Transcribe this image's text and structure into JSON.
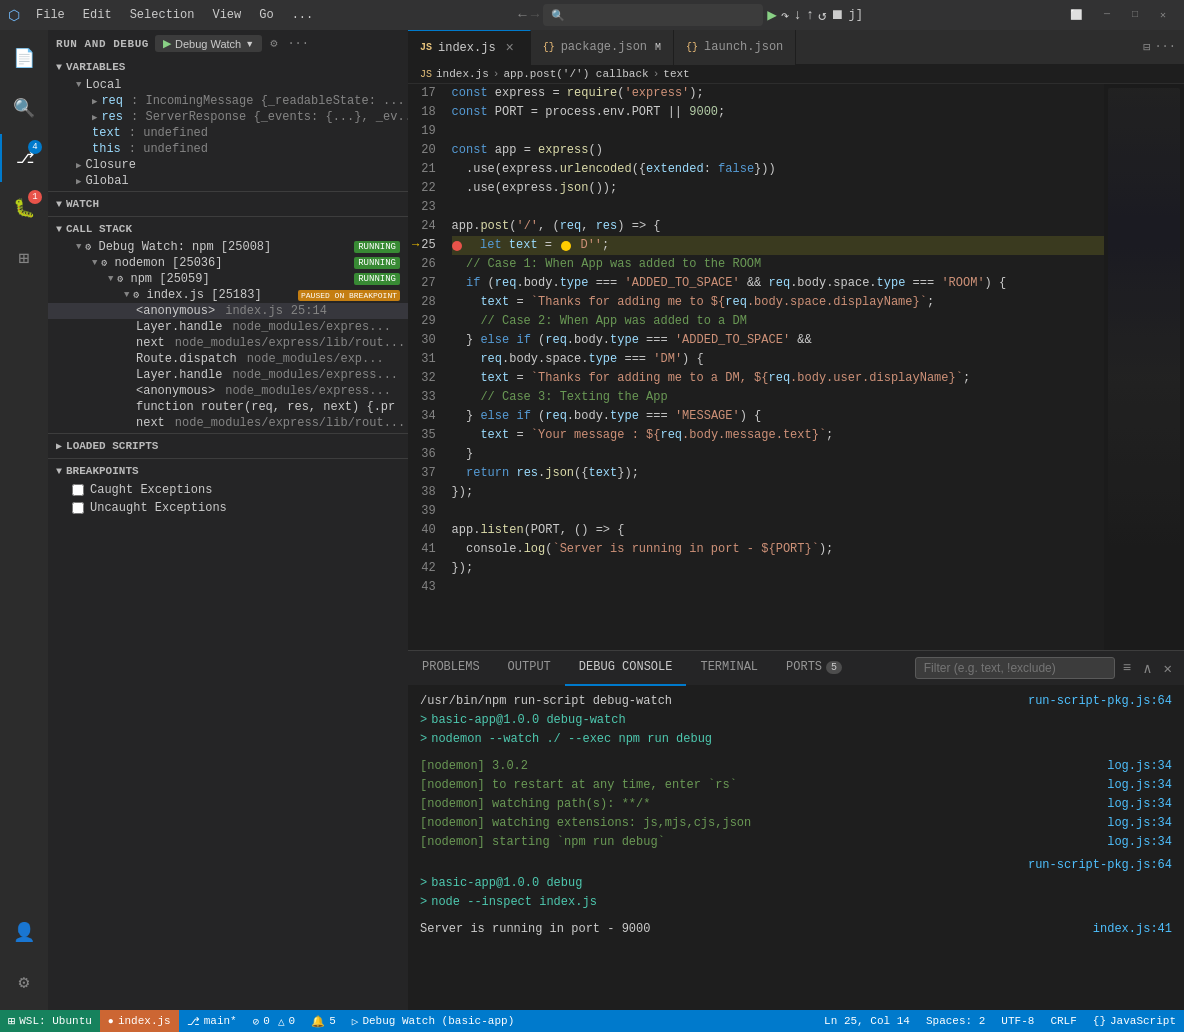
{
  "titlebar": {
    "icon": "⬡",
    "menus": [
      "File",
      "Edit",
      "Selection",
      "View",
      "Go",
      "..."
    ],
    "window_controls": [
      "─",
      "□",
      "✕"
    ]
  },
  "debug_toolbar": {
    "buttons": [
      "▶",
      "↺",
      "→",
      "↘",
      "↑",
      "⟳",
      "☐",
      "⚡"
    ]
  },
  "sidebar": {
    "title": "RUN AND DEBUG",
    "config_label": "Debug Watch",
    "sections": {
      "variables": {
        "label": "VARIABLES",
        "local": {
          "label": "Local",
          "items": [
            {
              "name": "req",
              "type": "IncomingMessage",
              "value": "{_readableState: ..."
            },
            {
              "name": "res",
              "type": "ServerResponse",
              "value": "{_events: {...}, _ev..."
            },
            {
              "name": "text",
              "value": "undefined"
            },
            {
              "name": "this",
              "value": "undefined"
            }
          ]
        },
        "closure": {
          "label": "Closure"
        },
        "global": {
          "label": "Global"
        }
      },
      "watch": {
        "label": "WATCH"
      },
      "call_stack": {
        "label": "CALL STACK",
        "threads": [
          {
            "name": "Debug Watch: npm [25008]",
            "badge": "RUNNING",
            "children": [
              {
                "name": "nodemon [25036]",
                "badge": "RUNNING",
                "children": [
                  {
                    "name": "npm [25059]",
                    "badge": "RUNNING",
                    "children": [
                      {
                        "name": "index.js [25183]",
                        "badge": "PAUSED ON BREAKPOINT",
                        "frames": [
                          {
                            "name": "<anonymous>",
                            "file": "index.js",
                            "line": "25:14"
                          },
                          {
                            "name": "Layer.handle",
                            "file": "node_modules/express..."
                          },
                          {
                            "name": "next",
                            "file": "node_modules/express/lib/rout..."
                          },
                          {
                            "name": "Route.dispatch",
                            "file": "node_modules/exp..."
                          },
                          {
                            "name": "Layer.handle",
                            "file": "node_modules/express..."
                          },
                          {
                            "name": "<anonymous>",
                            "file": "node_modules/express..."
                          },
                          {
                            "name": "function router(req, res, next) {.pr"
                          },
                          {
                            "name": "next",
                            "file": "node_modules/express/lib/rout..."
                          }
                        ]
                      }
                    ]
                  }
                ]
              }
            ]
          }
        ]
      },
      "loaded_scripts": {
        "label": "LOADED SCRIPTS"
      },
      "breakpoints": {
        "label": "BREAKPOINTS",
        "items": [
          {
            "label": "Caught Exceptions",
            "checked": false
          },
          {
            "label": "Uncaught Exceptions",
            "checked": false
          }
        ]
      }
    }
  },
  "editor": {
    "tabs": [
      {
        "label": "index.js",
        "icon": "JS",
        "active": true,
        "closeable": true
      },
      {
        "label": "package.json",
        "icon": "{}",
        "modified": true,
        "closeable": false
      },
      {
        "label": "launch.json",
        "icon": "{}",
        "active": false,
        "closeable": false
      }
    ],
    "breadcrumb": [
      "JS index.js",
      "app.post('/') callback",
      "text"
    ],
    "current_line": 25,
    "lines": [
      {
        "num": 17,
        "code": "const express = require('express');"
      },
      {
        "num": 18,
        "code": "const PORT = process.env.PORT || 9000;"
      },
      {
        "num": 19,
        "code": ""
      },
      {
        "num": 20,
        "code": "const app = express()"
      },
      {
        "num": 21,
        "code": "  .use(express.urlencoded({extended: false}))"
      },
      {
        "num": 22,
        "code": "  .use(express.json());"
      },
      {
        "num": 23,
        "code": ""
      },
      {
        "num": 24,
        "code": "app.post('/', (req, res) => {"
      },
      {
        "num": 25,
        "code": "  let text = ● D'';",
        "current": true,
        "breakpoint": true
      },
      {
        "num": 26,
        "code": "  // Case 1: When App was added to the ROOM"
      },
      {
        "num": 27,
        "code": "  if (req.body.type === 'ADDED_TO_SPACE' && req.body.space.type === 'ROOM') {"
      },
      {
        "num": 28,
        "code": "    text = `Thanks for adding me to ${req.body.space.displayName}`;"
      },
      {
        "num": 29,
        "code": "    // Case 2: When App was added to a DM"
      },
      {
        "num": 30,
        "code": "  } else if (req.body.type === 'ADDED_TO_SPACE' &&"
      },
      {
        "num": 31,
        "code": "    req.body.space.type === 'DM') {"
      },
      {
        "num": 32,
        "code": "    text = `Thanks for adding me to a DM, ${req.body.user.displayName}`;"
      },
      {
        "num": 33,
        "code": "    // Case 3: Texting the App"
      },
      {
        "num": 34,
        "code": "  } else if (req.body.type === 'MESSAGE') {"
      },
      {
        "num": 35,
        "code": "    text = `Your message : ${req.body.message.text}`;"
      },
      {
        "num": 36,
        "code": "  }"
      },
      {
        "num": 37,
        "code": "  return res.json({text});"
      },
      {
        "num": 38,
        "code": "});"
      },
      {
        "num": 39,
        "code": ""
      },
      {
        "num": 40,
        "code": "app.listen(PORT, () => {"
      },
      {
        "num": 41,
        "code": "  console.log(`Server is running in port - ${PORT}`);"
      },
      {
        "num": 42,
        "code": "});"
      },
      {
        "num": 43,
        "code": ""
      }
    ]
  },
  "panel": {
    "tabs": [
      "PROBLEMS",
      "OUTPUT",
      "DEBUG CONSOLE",
      "TERMINAL",
      "PORTS"
    ],
    "active_tab": "DEBUG CONSOLE",
    "ports_badge": "5",
    "filter_placeholder": "Filter (e.g. text, !exclude)",
    "console_lines": [
      {
        "type": "cmd",
        "text": "/usr/bin/npm run-script debug-watch",
        "link": "run-script-pkg.js:64"
      },
      {
        "type": "output",
        "text": "> basic-app@1.0.0 debug-watch"
      },
      {
        "type": "output",
        "text": "> nodemon --watch ./ --exec npm run debug"
      },
      {
        "type": "empty"
      },
      {
        "type": "green",
        "text": "[nodemon] 3.0.2",
        "link": "log.js:34"
      },
      {
        "type": "green",
        "text": "[nodemon] to restart at any time, enter `rs`",
        "link": "log.js:34"
      },
      {
        "type": "green",
        "text": "[nodemon] watching path(s): **/*",
        "link": "log.js:34"
      },
      {
        "type": "green",
        "text": "[nodemon] watching extensions: js,mjs,cjs,json",
        "link": "log.js:34"
      },
      {
        "type": "green",
        "text": "[nodemon] starting `npm run debug`",
        "link": "log.js:34"
      },
      {
        "type": "empty2"
      },
      {
        "type": "output",
        "text": "> basic-app@1.0.0 debug"
      },
      {
        "type": "output",
        "text": "> node --inspect index.js"
      },
      {
        "type": "empty3"
      },
      {
        "type": "white",
        "text": "Server is running in port - 9000",
        "link": "index.js:41"
      }
    ]
  },
  "statusbar": {
    "left": [
      {
        "icon": "⚡",
        "text": "WSL: Ubuntu"
      },
      {
        "icon": "⎇",
        "text": "main*"
      },
      {
        "icon": "⊘",
        "text": "0 △ 0"
      },
      {
        "icon": "⚠",
        "text": "5"
      },
      {
        "icon": "▷",
        "text": "Debug Watch (basic-app)"
      }
    ],
    "right": [
      {
        "text": "Ln 25, Col 14"
      },
      {
        "text": "Spaces: 2"
      },
      {
        "text": "UTF-8"
      },
      {
        "text": "CRLF"
      },
      {
        "text": "{} JavaScript"
      }
    ],
    "file": "index.js"
  }
}
